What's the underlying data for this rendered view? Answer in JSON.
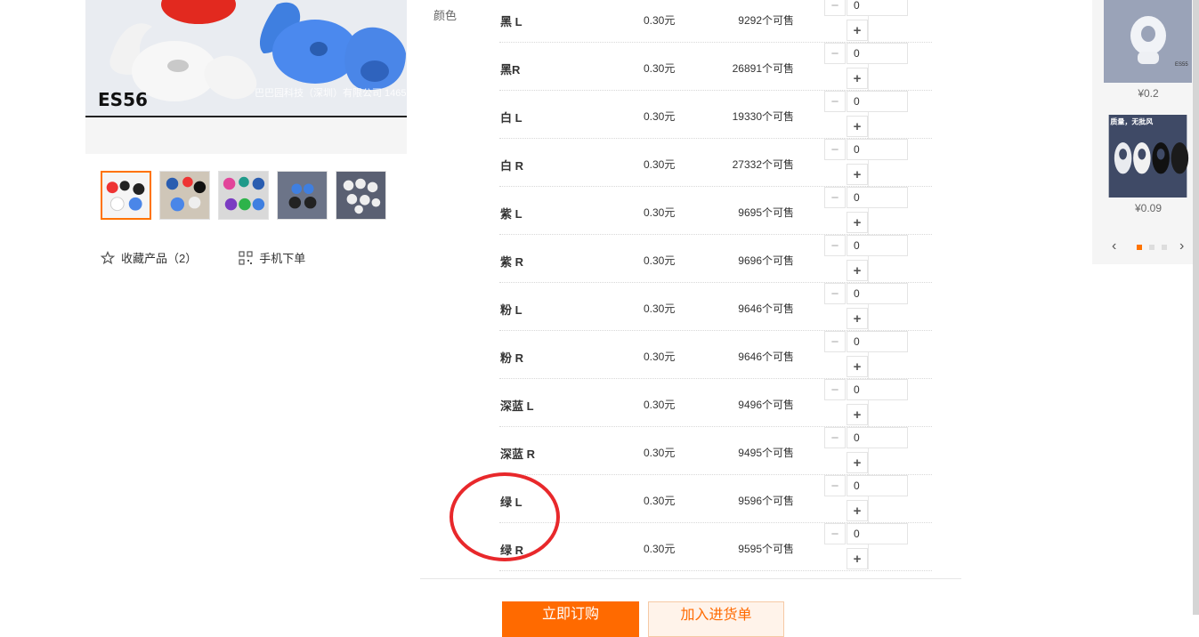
{
  "gallery": {
    "main_caption": "ES56",
    "main_watermark": "巴巴园科技（深圳）有限公司 1465870518553.1688.com",
    "thumbnails": [
      "thumb-1",
      "thumb-2",
      "thumb-3",
      "thumb-4",
      "thumb-5"
    ],
    "favorite_label": "收藏产品（2）",
    "mobile_order_label": "手机下单"
  },
  "sku": {
    "attr_label": "颜色",
    "rows": [
      {
        "name": "黑 L",
        "price": "0.30元",
        "stock": "9292个可售",
        "qty": "0"
      },
      {
        "name": "黑R",
        "price": "0.30元",
        "stock": "26891个可售",
        "qty": "0"
      },
      {
        "name": "白 L",
        "price": "0.30元",
        "stock": "19330个可售",
        "qty": "0"
      },
      {
        "name": "白 R",
        "price": "0.30元",
        "stock": "27332个可售",
        "qty": "0"
      },
      {
        "name": "紫 L",
        "price": "0.30元",
        "stock": "9695个可售",
        "qty": "0"
      },
      {
        "name": "紫 R",
        "price": "0.30元",
        "stock": "9696个可售",
        "qty": "0"
      },
      {
        "name": "粉 L",
        "price": "0.30元",
        "stock": "9646个可售",
        "qty": "0"
      },
      {
        "name": "粉 R",
        "price": "0.30元",
        "stock": "9646个可售",
        "qty": "0"
      },
      {
        "name": "深蓝 L",
        "price": "0.30元",
        "stock": "9496个可售",
        "qty": "0"
      },
      {
        "name": "深蓝 R",
        "price": "0.30元",
        "stock": "9495个可售",
        "qty": "0"
      },
      {
        "name": "绿 L",
        "price": "0.30元",
        "stock": "9596个可售",
        "qty": "0"
      },
      {
        "name": "绿 R",
        "price": "0.30元",
        "stock": "9595个可售",
        "qty": "0"
      }
    ],
    "minus_symbol": "−",
    "plus_symbol": "+"
  },
  "actions": {
    "buy_label": "立即订购",
    "cart_label": "加入进货单"
  },
  "recommend": {
    "items": [
      {
        "price": "¥0.2",
        "img_text": "ES55"
      },
      {
        "price": "¥0.09",
        "img_text": "质量，无批风"
      }
    ],
    "prev": "‹",
    "next": "›"
  },
  "colors": {
    "accent": "#ff6a00",
    "annotation": "#e8282b"
  }
}
